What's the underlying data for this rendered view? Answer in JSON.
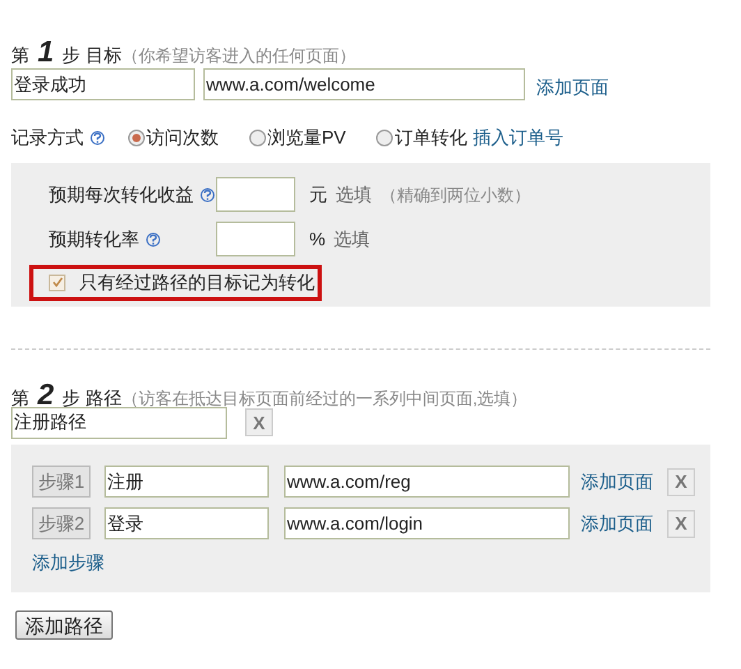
{
  "goal": {
    "prefix": "第",
    "number": "1",
    "suffix": "步 目标",
    "hint": "（你希望访客进入的任何页面）",
    "name_value": "登录成功",
    "url_value": "www.a.com/welcome",
    "add_page_link": "添加页面"
  },
  "record": {
    "label": "记录方式",
    "options": [
      {
        "label": "访问次数",
        "selected": true
      },
      {
        "label": "浏览量PV",
        "selected": false
      },
      {
        "label": "订单转化",
        "selected": false
      }
    ],
    "insert_link": "插入订单号"
  },
  "fields": [
    {
      "label": "预期每次转化收益",
      "unit": "元",
      "note": "选填",
      "extra_note": "（精确到两位小数）"
    },
    {
      "label": "预期转化率",
      "unit": "%",
      "note": "选填"
    }
  ],
  "path_only": {
    "label": "只有经过路径的目标记为转化",
    "checked": true,
    "highlighted": true
  },
  "path": {
    "prefix": "第",
    "number": "2",
    "suffix": "步 路径",
    "hint": "（访客在抵达目标页面前经过的一系列中间页面,选填）",
    "name_value": "注册路径",
    "remove_label": "X",
    "steps": [
      {
        "badge": "步骤1",
        "name_value": "注册",
        "url_value": "www.a.com/reg",
        "add_page_link": "添加页面",
        "remove_label": "X"
      },
      {
        "badge": "步骤2",
        "name_value": "登录",
        "url_value": "www.a.com/login",
        "add_page_link": "添加页面",
        "remove_label": "X"
      }
    ],
    "add_step_link": "添加步骤"
  },
  "add_path_button": "添加路径"
}
